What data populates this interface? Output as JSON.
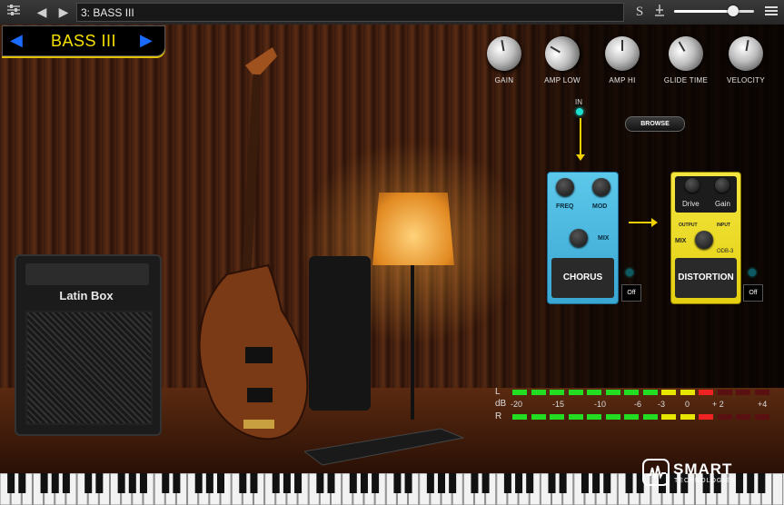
{
  "toolbar": {
    "preset_label": "3: BASS III",
    "s_label": "S",
    "volume_percent": 74
  },
  "nav": {
    "title": "BASS III",
    "prev_icon": "triangle-left-icon",
    "next_icon": "triangle-right-icon"
  },
  "scene": {
    "amp_brand": "Latin Box"
  },
  "knobs": [
    {
      "label": "GAIN"
    },
    {
      "label": "AMP LOW"
    },
    {
      "label": "AMP HI"
    },
    {
      "label": "GLIDE TIME"
    },
    {
      "label": "VELOCITY"
    }
  ],
  "chain": {
    "in_label": "IN",
    "browse_label": "BROWSE"
  },
  "chorus": {
    "freq_label": "FREQ",
    "mod_label": "MOD",
    "mix_label": "MIX",
    "name": "CHORUS",
    "toggle_label": "Off"
  },
  "distortion": {
    "drive_label": "Drive",
    "gain_label": "Gain",
    "output_label": "OUTPUT",
    "input_label": "INPUT",
    "mix_label": "MIX",
    "model": "ODB-3",
    "name": "DISTORTION",
    "toggle_label": "Off"
  },
  "meter": {
    "left_label": "L",
    "db_label": "dB",
    "right_label": "R",
    "scale": [
      "-20",
      "-15",
      "-10",
      "-6",
      "-3",
      "0",
      "+ 2",
      "+4"
    ],
    "colors": {
      "green": "#22dd22",
      "yellow": "#e6e600",
      "red": "#ee2222",
      "dim_red": "#5a1010"
    }
  },
  "brand": {
    "name": "SMART",
    "sub": "TECHNOLOGIES"
  },
  "colors": {
    "accent_yellow": "#f5e100",
    "nav_arrow_blue": "#1a6aff",
    "chorus_blue": "#4ab8e0",
    "distortion_yellow": "#f0dc20"
  }
}
